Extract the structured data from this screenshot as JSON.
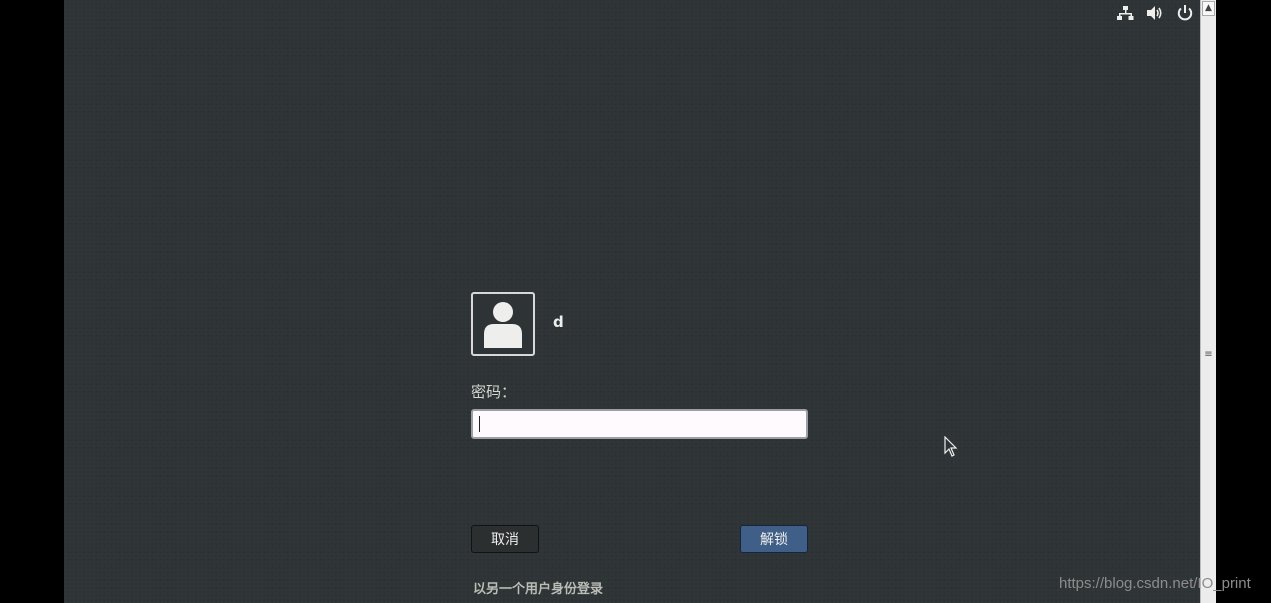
{
  "top_bar": {
    "icons": [
      "network-icon",
      "volume-icon",
      "power-icon"
    ]
  },
  "lock_screen": {
    "user_name": "d",
    "password_label": "密码：",
    "password_value": "",
    "cancel_label": "取消",
    "unlock_label": "解锁",
    "switch_user_label": "以另一个用户身份登录"
  },
  "scrollbar": {
    "up_arrow": "▲",
    "grip": "≡"
  },
  "watermark": "https://blog.csdn.net/IO_print",
  "colors": {
    "background": "#2e3436",
    "unlock_button": "#3f5f88",
    "input_background": "#fffafd"
  }
}
